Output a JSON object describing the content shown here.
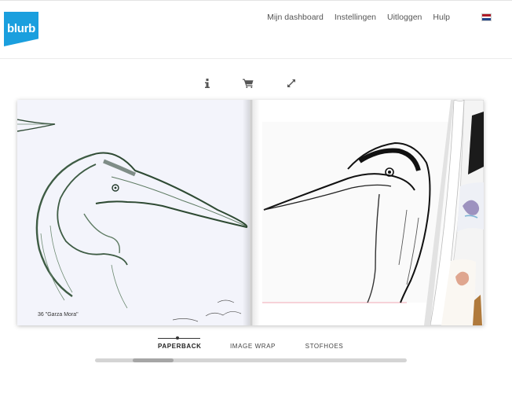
{
  "header": {
    "logo_text": "blurb",
    "nav": [
      "Mijn dashboard",
      "Instellingen",
      "Uitloggen",
      "Hulp"
    ],
    "flag_colors": [
      "#ae1c28",
      "#ffffff",
      "#21468b"
    ]
  },
  "toolbar": {
    "icons": [
      "info-icon",
      "cart-icon",
      "expand-icon"
    ]
  },
  "book": {
    "left_page_caption": "36 \"Garza Mora\"",
    "left_page_bg": "#f3f4fb"
  },
  "tabs": [
    "PAPERBACK",
    "IMAGE WRAP",
    "STOFHOES"
  ],
  "active_tab": "PAPERBACK",
  "colors": {
    "brand": "#1a9fde"
  }
}
